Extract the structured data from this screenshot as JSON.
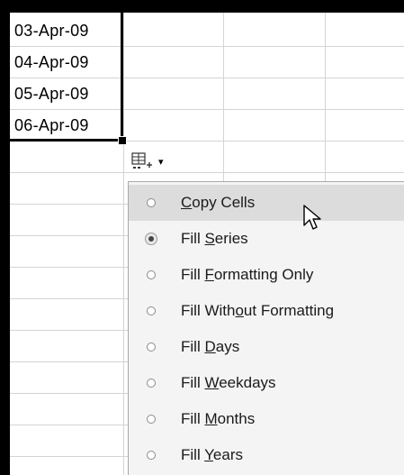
{
  "cells": [
    {
      "value": "03-Apr-09"
    },
    {
      "value": "04-Apr-09"
    },
    {
      "value": "05-Apr-09"
    },
    {
      "value": "06-Apr-09"
    }
  ],
  "autofill_button": {
    "icon": "autofill-options-icon",
    "caret": "▾"
  },
  "menu": {
    "items": [
      {
        "pre": "",
        "u": "C",
        "post": "opy Cells",
        "checked": false
      },
      {
        "pre": "Fill ",
        "u": "S",
        "post": "eries",
        "checked": true
      },
      {
        "pre": "Fill ",
        "u": "F",
        "post": "ormatting Only",
        "checked": false
      },
      {
        "pre": "Fill With",
        "u": "o",
        "post": "ut Formatting",
        "checked": false
      },
      {
        "pre": "Fill ",
        "u": "D",
        "post": "ays",
        "checked": false
      },
      {
        "pre": "Fill ",
        "u": "W",
        "post": "eekdays",
        "checked": false
      },
      {
        "pre": "Fill ",
        "u": "M",
        "post": "onths",
        "checked": false
      },
      {
        "pre": "Fill ",
        "u": "Y",
        "post": "ears",
        "checked": false
      }
    ],
    "hovered_item": "Copy Cells"
  },
  "colors": {
    "menu_background": "#f4f4f4",
    "hover_background": "#dcdcdc",
    "selection_border": "#000000"
  }
}
